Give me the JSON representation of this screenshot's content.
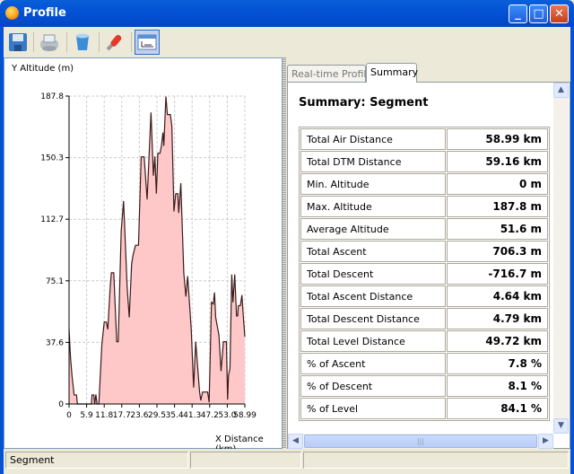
{
  "window": {
    "title": "Profile",
    "buttons": [
      "minimize",
      "maximize",
      "close"
    ]
  },
  "toolbar": {
    "items": [
      {
        "icon": "save-icon",
        "label": "Save"
      },
      {
        "icon": "print-icon",
        "label": "Print"
      },
      {
        "icon": "clear-icon",
        "label": "Clear"
      },
      {
        "icon": "settings-wrench-icon",
        "label": "Settings"
      },
      {
        "icon": "distance-axis-icon",
        "label": "Distance axis",
        "selected": true
      }
    ]
  },
  "chart_data": {
    "type": "area",
    "ylabel": "Y Altitude (m)",
    "xlabel": "X Distance (km)",
    "xlim": [
      0,
      58.99
    ],
    "ylim": [
      0,
      187.8
    ],
    "xticks": [
      "0",
      "5.9",
      "11.8",
      "17.7",
      "23.6",
      "29.5",
      "35.4",
      "41.3",
      "47.2",
      "53.0",
      "58.99"
    ],
    "yticks": [
      "0",
      "37.6",
      "75.1",
      "112.7",
      "150.3",
      "187.8"
    ],
    "grid": true,
    "fill_color": "#ffc8c8",
    "line_color": "#3a1a1a",
    "x": [
      0,
      0.5,
      1,
      1.7,
      2.5,
      2.8,
      6,
      7.5,
      7.7,
      8.3,
      8.6,
      9,
      9.4,
      10,
      11,
      11.8,
      12.5,
      13,
      13.8,
      14.2,
      15,
      16,
      16.5,
      17.5,
      18.3,
      19.5,
      20.2,
      21,
      21.5,
      22.3,
      23.3,
      24.2,
      25.2,
      26.2,
      27.5,
      28.3,
      28.8,
      29.3,
      29.8,
      30.5,
      31,
      31.5,
      31.8,
      32.5,
      33,
      34,
      34.5,
      35.2,
      35.8,
      36.5,
      36.8,
      37.5,
      38.5,
      39.2,
      39.8,
      41,
      41.8,
      42.5,
      43.8,
      44.2,
      44.8,
      46.5,
      47,
      47.8,
      48.4,
      48.8,
      49.2,
      50.3,
      51,
      51.8,
      52.8,
      53.2,
      53.5,
      54,
      54.6,
      55,
      55.6,
      56.2,
      56.6,
      56.8,
      57.5,
      58,
      58.5,
      58.99
    ],
    "y": [
      45.5,
      28,
      17,
      5.5,
      5.5,
      0,
      0,
      0,
      5.5,
      5.5,
      0,
      5.8,
      0,
      0,
      36,
      50,
      50,
      45.5,
      71,
      80,
      80,
      38,
      38,
      105.6,
      123.8,
      71,
      52.8,
      85.5,
      91,
      96.8,
      96.8,
      150.7,
      150.7,
      124.7,
      177.8,
      139.2,
      151,
      128.3,
      152.9,
      152.9,
      157.4,
      165.6,
      157.4,
      187.5,
      176.5,
      176.5,
      169.3,
      117.4,
      128.3,
      128.3,
      116.5,
      134.7,
      80,
      65.5,
      78,
      45.5,
      10,
      38,
      7.3,
      2.2,
      7.3,
      7.3,
      1,
      62,
      61,
      68,
      52.8,
      41.9,
      20,
      38,
      38,
      2.7,
      17.3,
      21.8,
      79,
      62,
      79,
      53.7,
      53.7,
      60,
      60,
      66.4,
      52.8,
      41
    ]
  },
  "tabs": [
    {
      "label": "Real-time Profile",
      "active": false
    },
    {
      "label": "Summary",
      "active": true
    }
  ],
  "summary": {
    "title": "Summary: Segment",
    "rows": [
      {
        "label": "Total Air Distance",
        "value": "58.99 km"
      },
      {
        "label": "Total DTM Distance",
        "value": "59.16 km"
      },
      {
        "label": "Min. Altitude",
        "value": "0 m"
      },
      {
        "label": "Max. Altitude",
        "value": "187.8 m"
      },
      {
        "label": "Average Altitude",
        "value": "51.6 m"
      },
      {
        "label": "Total Ascent",
        "value": "706.3 m"
      },
      {
        "label": "Total Descent",
        "value": "-716.7 m"
      },
      {
        "label": "Total Ascent Distance",
        "value": "4.64 km"
      },
      {
        "label": "Total Descent Distance",
        "value": "4.79 km"
      },
      {
        "label": "Total Level Distance",
        "value": "49.72 km"
      },
      {
        "label": "% of Ascent",
        "value": "7.8 %"
      },
      {
        "label": "% of Descent",
        "value": "8.1 %"
      },
      {
        "label": "% of Level",
        "value": "84.1 %"
      }
    ]
  },
  "statusbar": {
    "text": "Segment"
  }
}
